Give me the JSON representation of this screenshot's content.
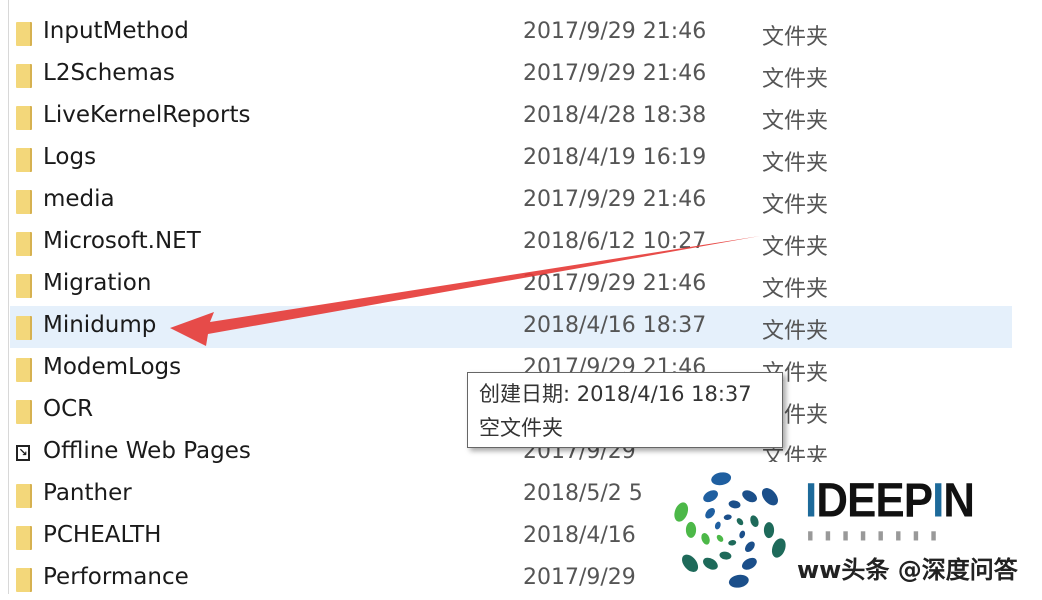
{
  "rows": [
    {
      "name": "InputMethod",
      "date": "2017/9/29 21:46",
      "type": "文件夹",
      "icon": "folder-icon"
    },
    {
      "name": "L2Schemas",
      "date": "2017/9/29 21:46",
      "type": "文件夹",
      "icon": "folder-icon"
    },
    {
      "name": "LiveKernelReports",
      "date": "2018/4/28 18:38",
      "type": "文件夹",
      "icon": "folder-icon"
    },
    {
      "name": "Logs",
      "date": "2018/4/19 16:19",
      "type": "文件夹",
      "icon": "folder-icon"
    },
    {
      "name": "media",
      "date": "2017/9/29 21:46",
      "type": "文件夹",
      "icon": "folder-icon"
    },
    {
      "name": "Microsoft.NET",
      "date": "2018/6/12 10:27",
      "type": "文件夹",
      "icon": "folder-icon"
    },
    {
      "name": "Migration",
      "date": "2017/9/29 21:46",
      "type": "文件夹",
      "icon": "folder-icon"
    },
    {
      "name": "Minidump",
      "date": "2018/4/16 18:37",
      "type": "文件夹",
      "icon": "folder-icon",
      "selected": true
    },
    {
      "name": "ModemLogs",
      "date": "2017/9/29 21:46",
      "type": "文件夹",
      "icon": "folder-icon"
    },
    {
      "name": "OCR",
      "date": "",
      "type": "文件夹",
      "icon": "folder-icon"
    },
    {
      "name": "Offline Web Pages",
      "date": "2017/9/29",
      "type": "文件夹",
      "icon": "web-page-icon"
    },
    {
      "name": "Panther",
      "date": "2018/5/2 5",
      "type": "",
      "icon": "folder-icon"
    },
    {
      "name": "PCHEALTH",
      "date": "2018/4/16",
      "type": "",
      "icon": "folder-icon"
    },
    {
      "name": "Performance",
      "date": "2017/9/29",
      "type": "",
      "icon": "folder-icon"
    }
  ],
  "tooltip": {
    "line1": "创建日期: 2018/4/16 18:37",
    "line2": "空文件夹"
  },
  "watermark": {
    "brand": "IDEEPIN",
    "text": "ww头条 @深度问答"
  },
  "colors": {
    "selection": "#e5f0fb",
    "arrow": "#e53935",
    "folder": "#f3d77a"
  }
}
